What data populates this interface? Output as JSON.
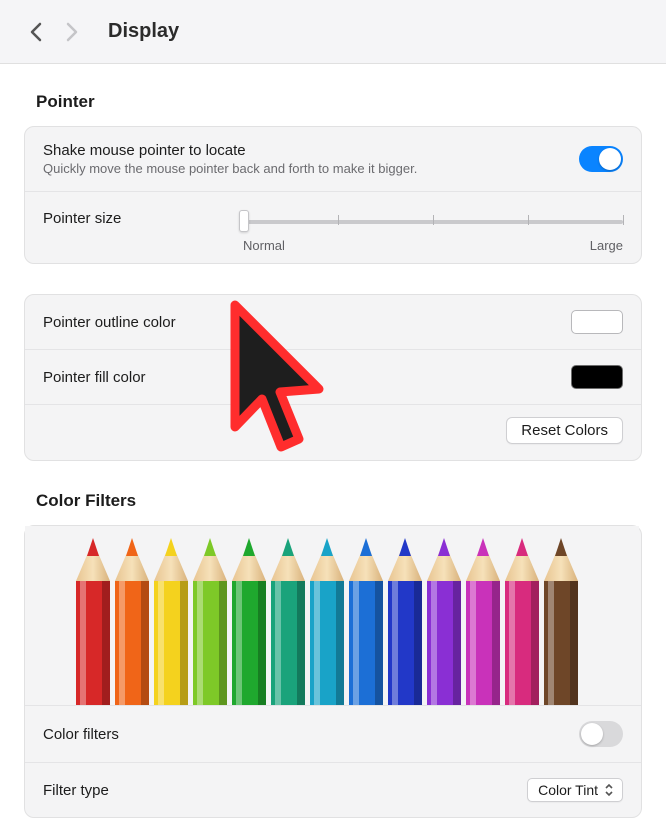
{
  "header": {
    "title": "Display"
  },
  "pointer_section": {
    "title": "Pointer",
    "shake": {
      "label": "Shake mouse pointer to locate",
      "sub": "Quickly move the mouse pointer back and forth to make it bigger.",
      "enabled": true
    },
    "size": {
      "label": "Pointer size",
      "minLabel": "Normal",
      "maxLabel": "Large",
      "value": 0,
      "ticks": 5
    },
    "outline": {
      "label": "Pointer outline color",
      "value": "#ffffff"
    },
    "fill": {
      "label": "Pointer fill color",
      "value": "#000000"
    },
    "reset_label": "Reset Colors"
  },
  "color_filters_section": {
    "title": "Color Filters",
    "toggle": {
      "label": "Color filters",
      "enabled": false
    },
    "filter_type": {
      "label": "Filter type",
      "value": "Color Tint"
    },
    "pencil_colors": [
      "#d72828",
      "#f06518",
      "#f4d21e",
      "#7ec928",
      "#1fa82e",
      "#1aa37b",
      "#19a3c8",
      "#1c6fd6",
      "#2238c8",
      "#8a2fd4",
      "#c932ba",
      "#d82b7e",
      "#6e4628"
    ]
  },
  "cursor": {
    "fill": "#1e1e1e",
    "outline": "#ff2d2d"
  }
}
